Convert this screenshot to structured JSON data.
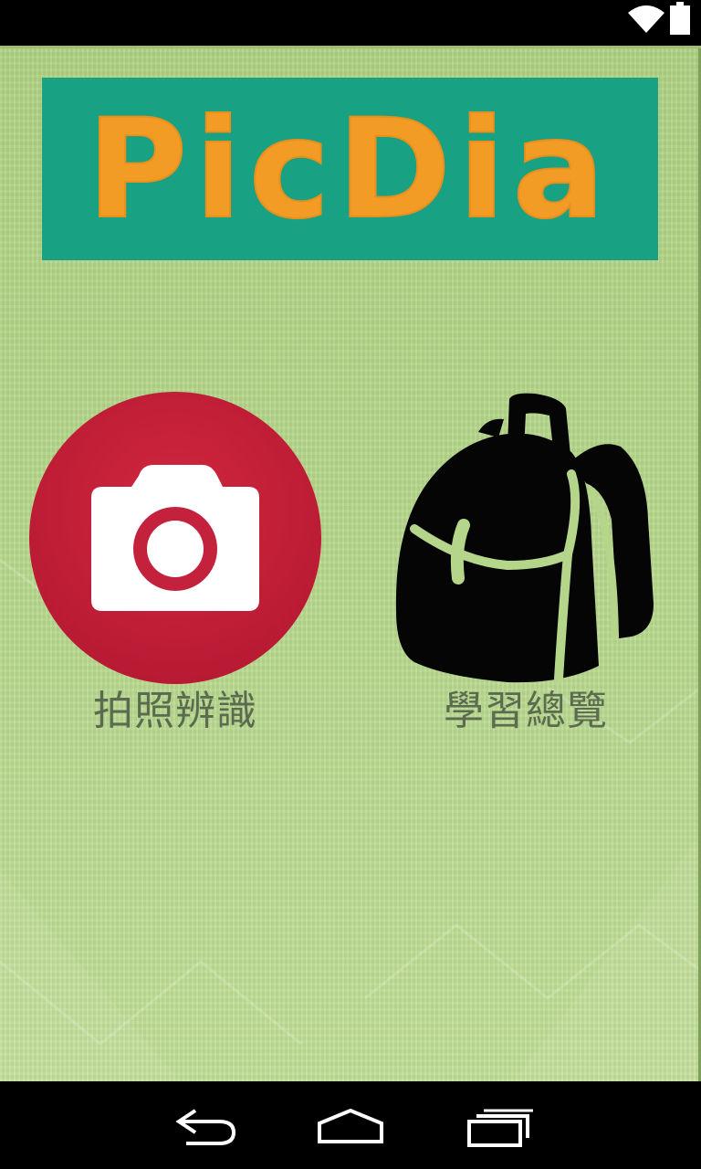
{
  "status_bar": {
    "wifi_icon": "wifi-icon",
    "battery_icon": "battery-icon"
  },
  "app": {
    "logo_text": "PicDia",
    "colors": {
      "background": "#b5d68a",
      "logo_background": "#18a183",
      "logo_text": "#f29b25",
      "camera_circle": "#c4213d",
      "label_text": "#5b6b4f"
    },
    "tiles": [
      {
        "icon": "camera-icon",
        "label": "拍照辨識"
      },
      {
        "icon": "backpack-icon",
        "label": "學習總覽"
      }
    ]
  },
  "nav_bar": {
    "back_icon": "back-icon",
    "home_icon": "home-icon",
    "recents_icon": "recents-icon"
  }
}
